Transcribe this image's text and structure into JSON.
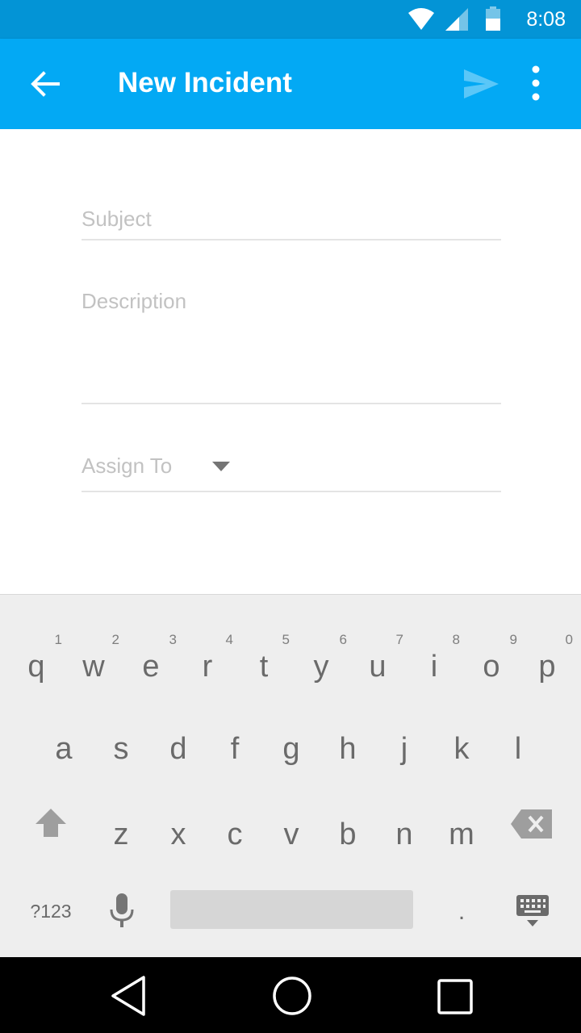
{
  "status_bar": {
    "time": "8:08"
  },
  "app_bar": {
    "title": "New Incident",
    "back_icon": "arrow-back-icon",
    "send_icon": "send-icon",
    "more_icon": "more-vert-icon"
  },
  "form": {
    "subject_placeholder": "Subject",
    "description_placeholder": "Description",
    "assign_to_placeholder": "Assign To"
  },
  "keyboard": {
    "row1": [
      {
        "letter": "q",
        "hint": "1"
      },
      {
        "letter": "w",
        "hint": "2"
      },
      {
        "letter": "e",
        "hint": "3"
      },
      {
        "letter": "r",
        "hint": "4"
      },
      {
        "letter": "t",
        "hint": "5"
      },
      {
        "letter": "y",
        "hint": "6"
      },
      {
        "letter": "u",
        "hint": "7"
      },
      {
        "letter": "i",
        "hint": "8"
      },
      {
        "letter": "o",
        "hint": "9"
      },
      {
        "letter": "p",
        "hint": "0"
      }
    ],
    "row2": [
      "a",
      "s",
      "d",
      "f",
      "g",
      "h",
      "j",
      "k",
      "l"
    ],
    "row3": [
      "z",
      "x",
      "c",
      "v",
      "b",
      "n",
      "m"
    ],
    "symbols_label": "?123",
    "period_label": ".",
    "shift_icon": "shift-icon",
    "delete_icon": "backspace-icon",
    "mic_icon": "microphone-icon",
    "keyboard_icon": "keyboard-hide-icon"
  },
  "colors": {
    "status_bar": "#0394d6",
    "app_bar": "#03a9f4",
    "placeholder": "#c2c2c2",
    "keyboard_bg": "#eeeeee"
  }
}
